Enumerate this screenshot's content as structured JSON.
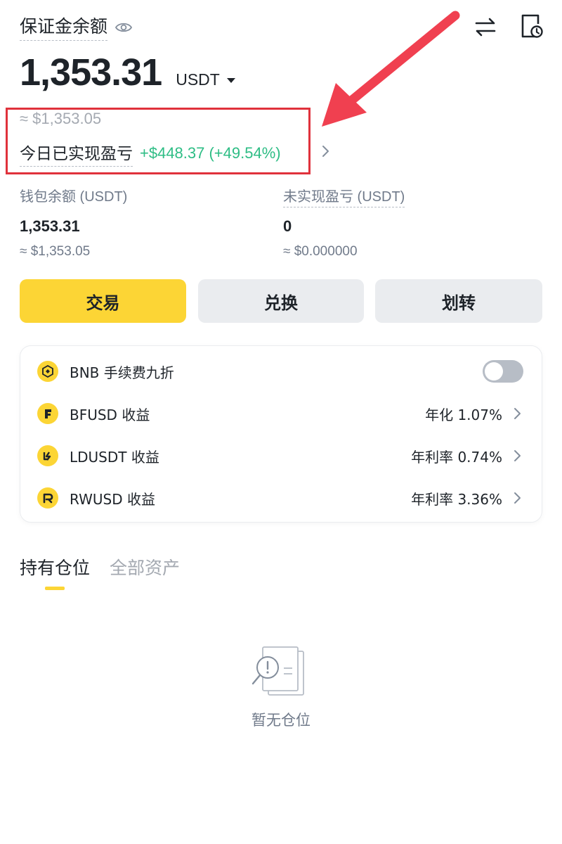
{
  "header": {
    "title": "保证金余额",
    "balance": "1,353.31",
    "currency": "USDT",
    "approx_usd": "≈ $1,353.05",
    "pnl_label": "今日已实现盈亏",
    "pnl_value": "+$448.37 (+49.54%)"
  },
  "stats": {
    "wallet": {
      "label": "钱包余额 (USDT)",
      "value": "1,353.31",
      "approx": "≈ $1,353.05"
    },
    "unrealized": {
      "label": "未实现盈亏 (USDT)",
      "value": "0",
      "approx": "≈ $0.000000"
    }
  },
  "actions": {
    "trade": "交易",
    "convert": "兑换",
    "transfer": "划转"
  },
  "features": [
    {
      "label": "BNB 手续费九折",
      "value": "",
      "toggle_on": false
    },
    {
      "label": "BFUSD 收益",
      "value": "年化 1.07%"
    },
    {
      "label": "LDUSDT 收益",
      "value": "年利率 0.74%"
    },
    {
      "label": "RWUSD 收益",
      "value": "年利率 3.36%"
    }
  ],
  "tabs": [
    "持有仓位",
    "全部资产"
  ],
  "empty_state": "暂无仓位",
  "colors": {
    "brand_yellow": "#fcd535",
    "profit_green": "#2ebd85",
    "annotation_red": "#e0323c"
  }
}
